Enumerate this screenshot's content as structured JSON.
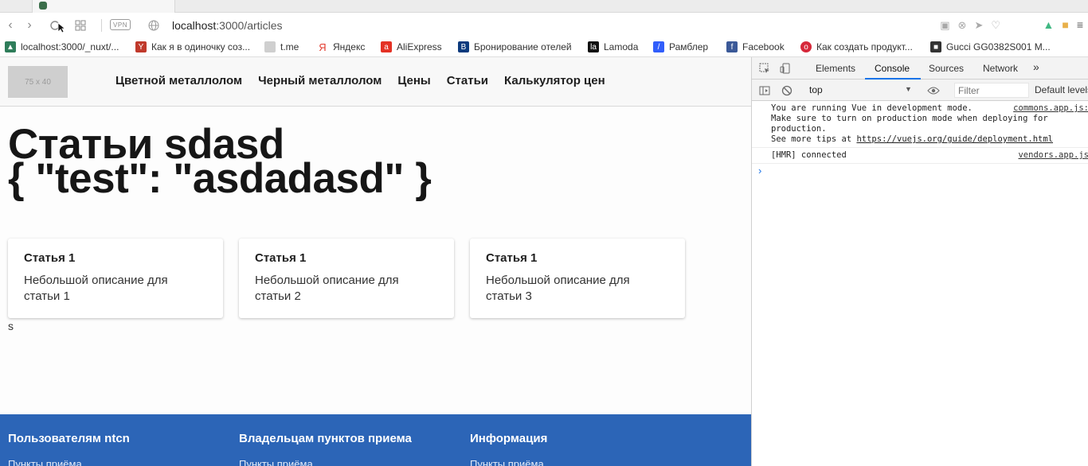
{
  "browser": {
    "vpn_label": "VPN",
    "url_host": "localhost",
    "url_path": ":3000/articles",
    "bookmarks": [
      {
        "label": "localhost:3000/_nuxt/...",
        "icon": "nuxt-icon",
        "color": "#2f7d5a"
      },
      {
        "label": "Как я в одиночку соз...",
        "icon": "ya-music-icon",
        "color": "#c0392b"
      },
      {
        "label": "t.me",
        "icon": "page-icon",
        "color": "#888888"
      },
      {
        "label": "Яндекс",
        "icon": "yandex-icon",
        "color": "#e33b2e"
      },
      {
        "label": "AliExpress",
        "icon": "aliexpress-icon",
        "color": "#e43225"
      },
      {
        "label": "Бронирование отелей",
        "icon": "booking-icon",
        "color": "#0b3a7d"
      },
      {
        "label": "Lamoda",
        "icon": "lamoda-icon",
        "color": "#111111"
      },
      {
        "label": "Рамблер",
        "icon": "rambler-icon",
        "color": "#315efb"
      },
      {
        "label": "Facebook",
        "icon": "facebook-icon",
        "color": "#3b5998"
      },
      {
        "label": "Как создать продукт...",
        "icon": "target-icon",
        "color": "#d6283a"
      },
      {
        "label": "Gucci GG0382S001 M...",
        "icon": "shop-icon",
        "color": "#333333"
      }
    ]
  },
  "site": {
    "logo_text": "75 x 40",
    "nav": [
      "Цветной металлолом",
      "Черный металлолом",
      "Цены",
      "Статьи",
      "Калькулятор цен"
    ],
    "title_line1": "Статьи sdasd",
    "title_line2": "{ \"test\": \"asdadasd\" }",
    "cards": [
      {
        "title": "Статья 1",
        "desc": "Небольшой описание для статьи 1"
      },
      {
        "title": "Статья 1",
        "desc": "Небольшой описание для статьи 2"
      },
      {
        "title": "Статья 1",
        "desc": "Небольшой описание для статьи 3"
      }
    ],
    "stray_text": "s",
    "footer": [
      {
        "heading": "Пользователям ntcn",
        "link": "Пункты приёма"
      },
      {
        "heading": "Владельцам пунктов приема",
        "link": "Пункты приёма"
      },
      {
        "heading": "Информация",
        "link": "Пункты приёма"
      }
    ],
    "footer_color": "#2c65b7"
  },
  "devtools": {
    "tabs": [
      "Elements",
      "Console",
      "Sources",
      "Network"
    ],
    "more_label": "»",
    "context": "top",
    "filter_placeholder": "Filter",
    "levels_label": "Default levels",
    "messages": [
      {
        "lines": [
          "You are running Vue in development mode.",
          "Make sure to turn on production mode when deploying for",
          "production."
        ],
        "tips_prefix": "See more tips at ",
        "tips_link": "https://vuejs.org/guide/deployment.html",
        "source": "commons.app.js:"
      },
      {
        "lines": [
          "[HMR] connected"
        ],
        "source": "vendors.app.js"
      }
    ],
    "prompt": "›"
  }
}
